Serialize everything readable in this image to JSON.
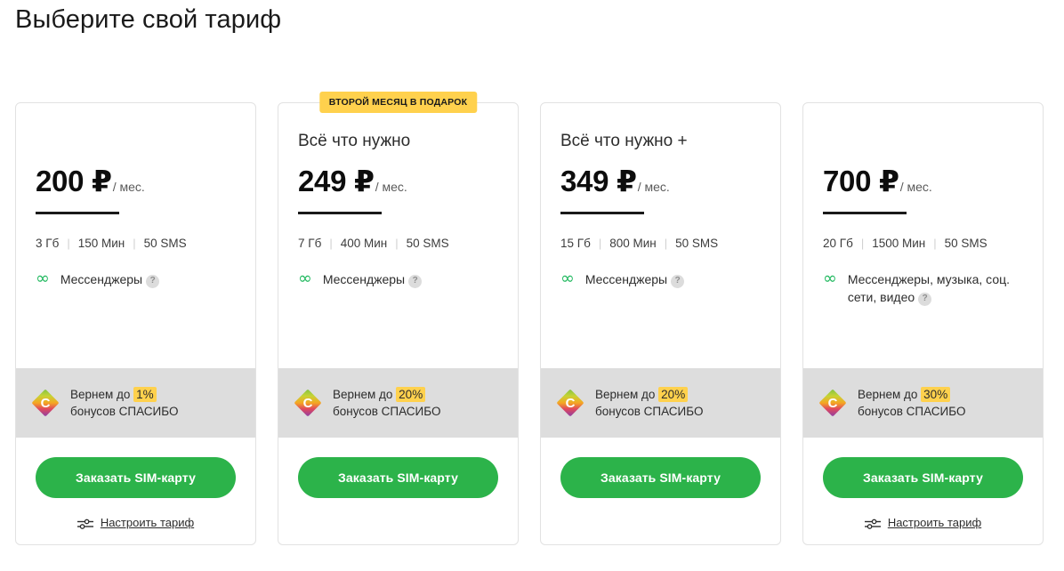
{
  "header": {
    "title": "Выберите свой тариф"
  },
  "labels": {
    "per_month": "/ мес.",
    "currency": "₽",
    "spec_separator": "|",
    "help_icon": "?",
    "infinity_icon": "∞",
    "cashback_prefix": "Вернем до",
    "cashback_suffix": "бонусов СПАСИБО",
    "spasibo_letter": "С",
    "order_button": "Заказать SIM-карту",
    "configure_link": "Настроить тариф"
  },
  "colors": {
    "accent_green": "#2cb34a",
    "infinity_green": "#1fb85e",
    "badge_yellow": "#ffd14d",
    "cashback_bg": "#dddddd",
    "card_border": "#e2e2e2"
  },
  "plans": [
    {
      "badge": "",
      "name": "",
      "price": "200",
      "data": "3 Гб",
      "minutes": "150 Мин",
      "sms": "50 SMS",
      "extras": "Мессенджеры",
      "cashback_percent": "1%",
      "has_configure_link": true
    },
    {
      "badge": "ВТОРОЙ МЕСЯЦ В ПОДАРОК",
      "name": "Всё что нужно",
      "price": "249",
      "data": "7 Гб",
      "minutes": "400 Мин",
      "sms": "50 SMS",
      "extras": "Мессенджеры",
      "cashback_percent": "20%",
      "has_configure_link": false
    },
    {
      "badge": "",
      "name": "Всё что нужно +",
      "price": "349",
      "data": "15 Гб",
      "minutes": "800 Мин",
      "sms": "50 SMS",
      "extras": "Мессенджеры",
      "cashback_percent": "20%",
      "has_configure_link": false
    },
    {
      "badge": "",
      "name": "",
      "price": "700",
      "data": "20 Гб",
      "minutes": "1500 Мин",
      "sms": "50 SMS",
      "extras": "Мессенджеры, музыка, соц. сети, видео",
      "cashback_percent": "30%",
      "has_configure_link": true
    }
  ]
}
